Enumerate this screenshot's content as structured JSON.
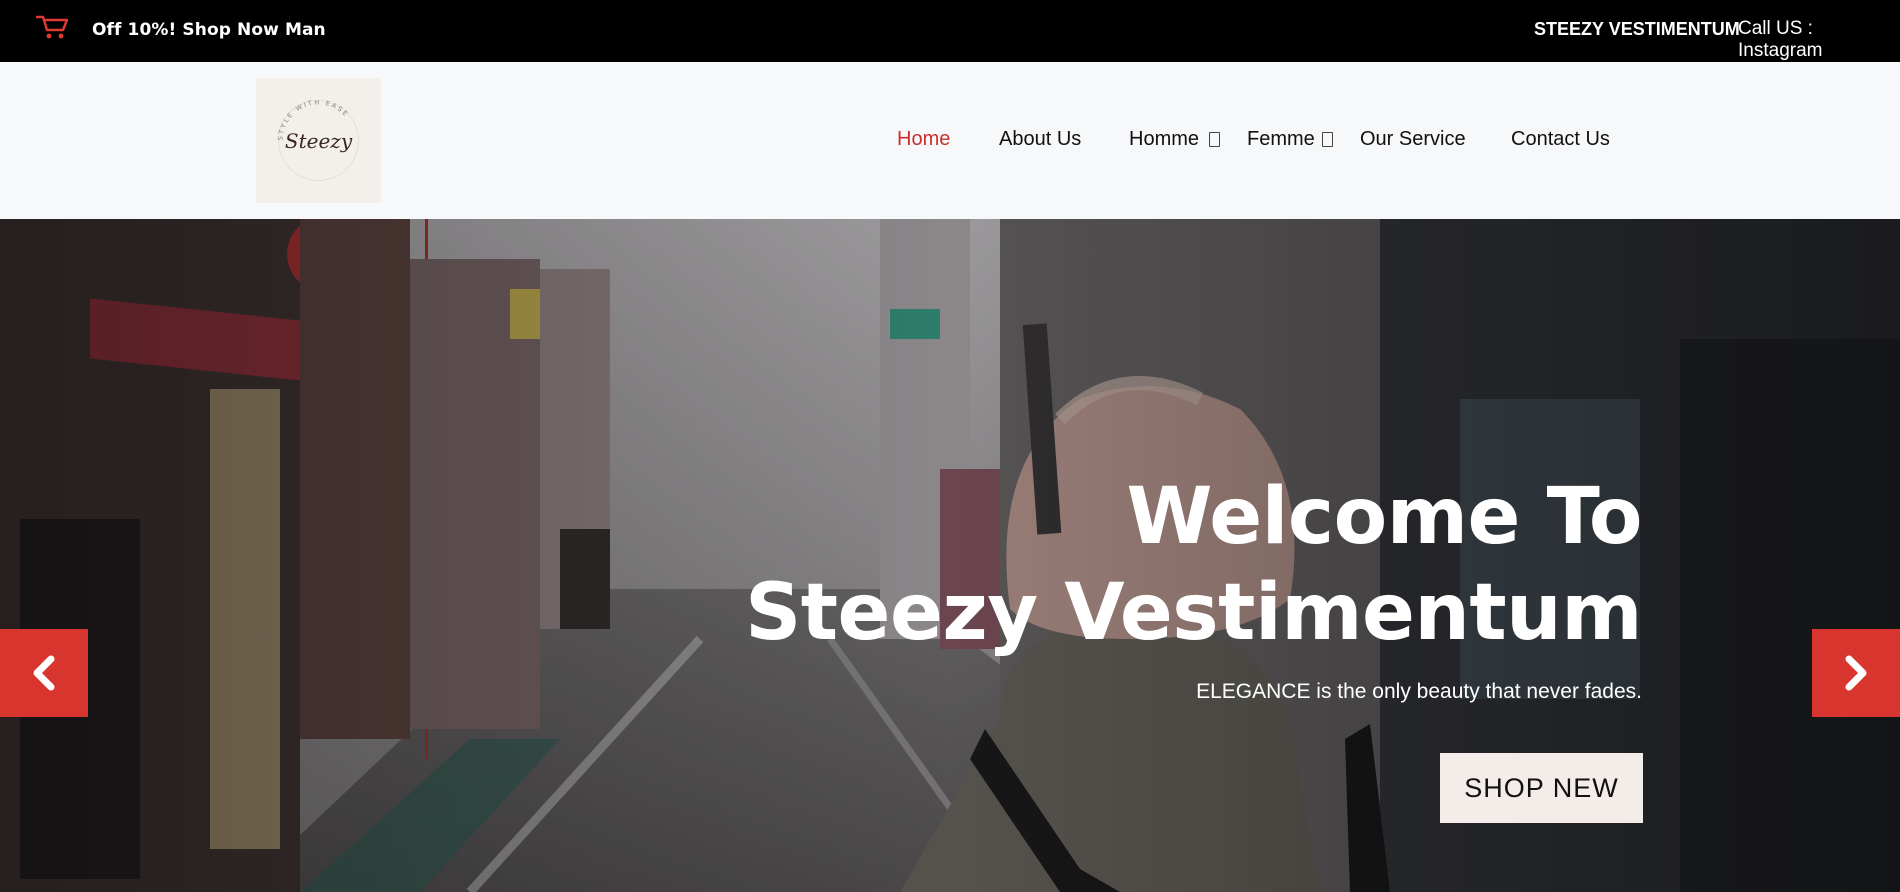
{
  "topbar": {
    "promo": "Off 10%! Shop Now Man",
    "brand": "STEEZY VESTIMENTUM",
    "call_us": "Call US : Instagram",
    "cart_icon": "shopping-cart-icon"
  },
  "header": {
    "logo": {
      "script_text": "Steezy",
      "ring_text": "STYLE WITH EASE",
      "icon": "steezy-logo"
    },
    "nav": [
      {
        "label": "Home",
        "active": true
      },
      {
        "label": "About Us",
        "active": false
      },
      {
        "label": "Homme",
        "has_dropdown": true
      },
      {
        "label": "Femme",
        "has_dropdown": true
      },
      {
        "label": "Our Service",
        "active": false
      },
      {
        "label": "Contact Us",
        "active": false
      }
    ]
  },
  "hero": {
    "title_line1": "Welcome To",
    "title_line2": "Steezy Vestimentum",
    "subtitle": "ELEGANCE is the only beauty that never fades.",
    "cta_label": "SHOP NEW",
    "prev_icon": "chevron-left-icon",
    "next_icon": "chevron-right-icon"
  },
  "colors": {
    "accent": "#d9352f",
    "active_nav": "#c9302c",
    "topbar_bg": "#000000",
    "header_bg": "#f7f8fa",
    "cta_bg": "#f4ece8"
  }
}
